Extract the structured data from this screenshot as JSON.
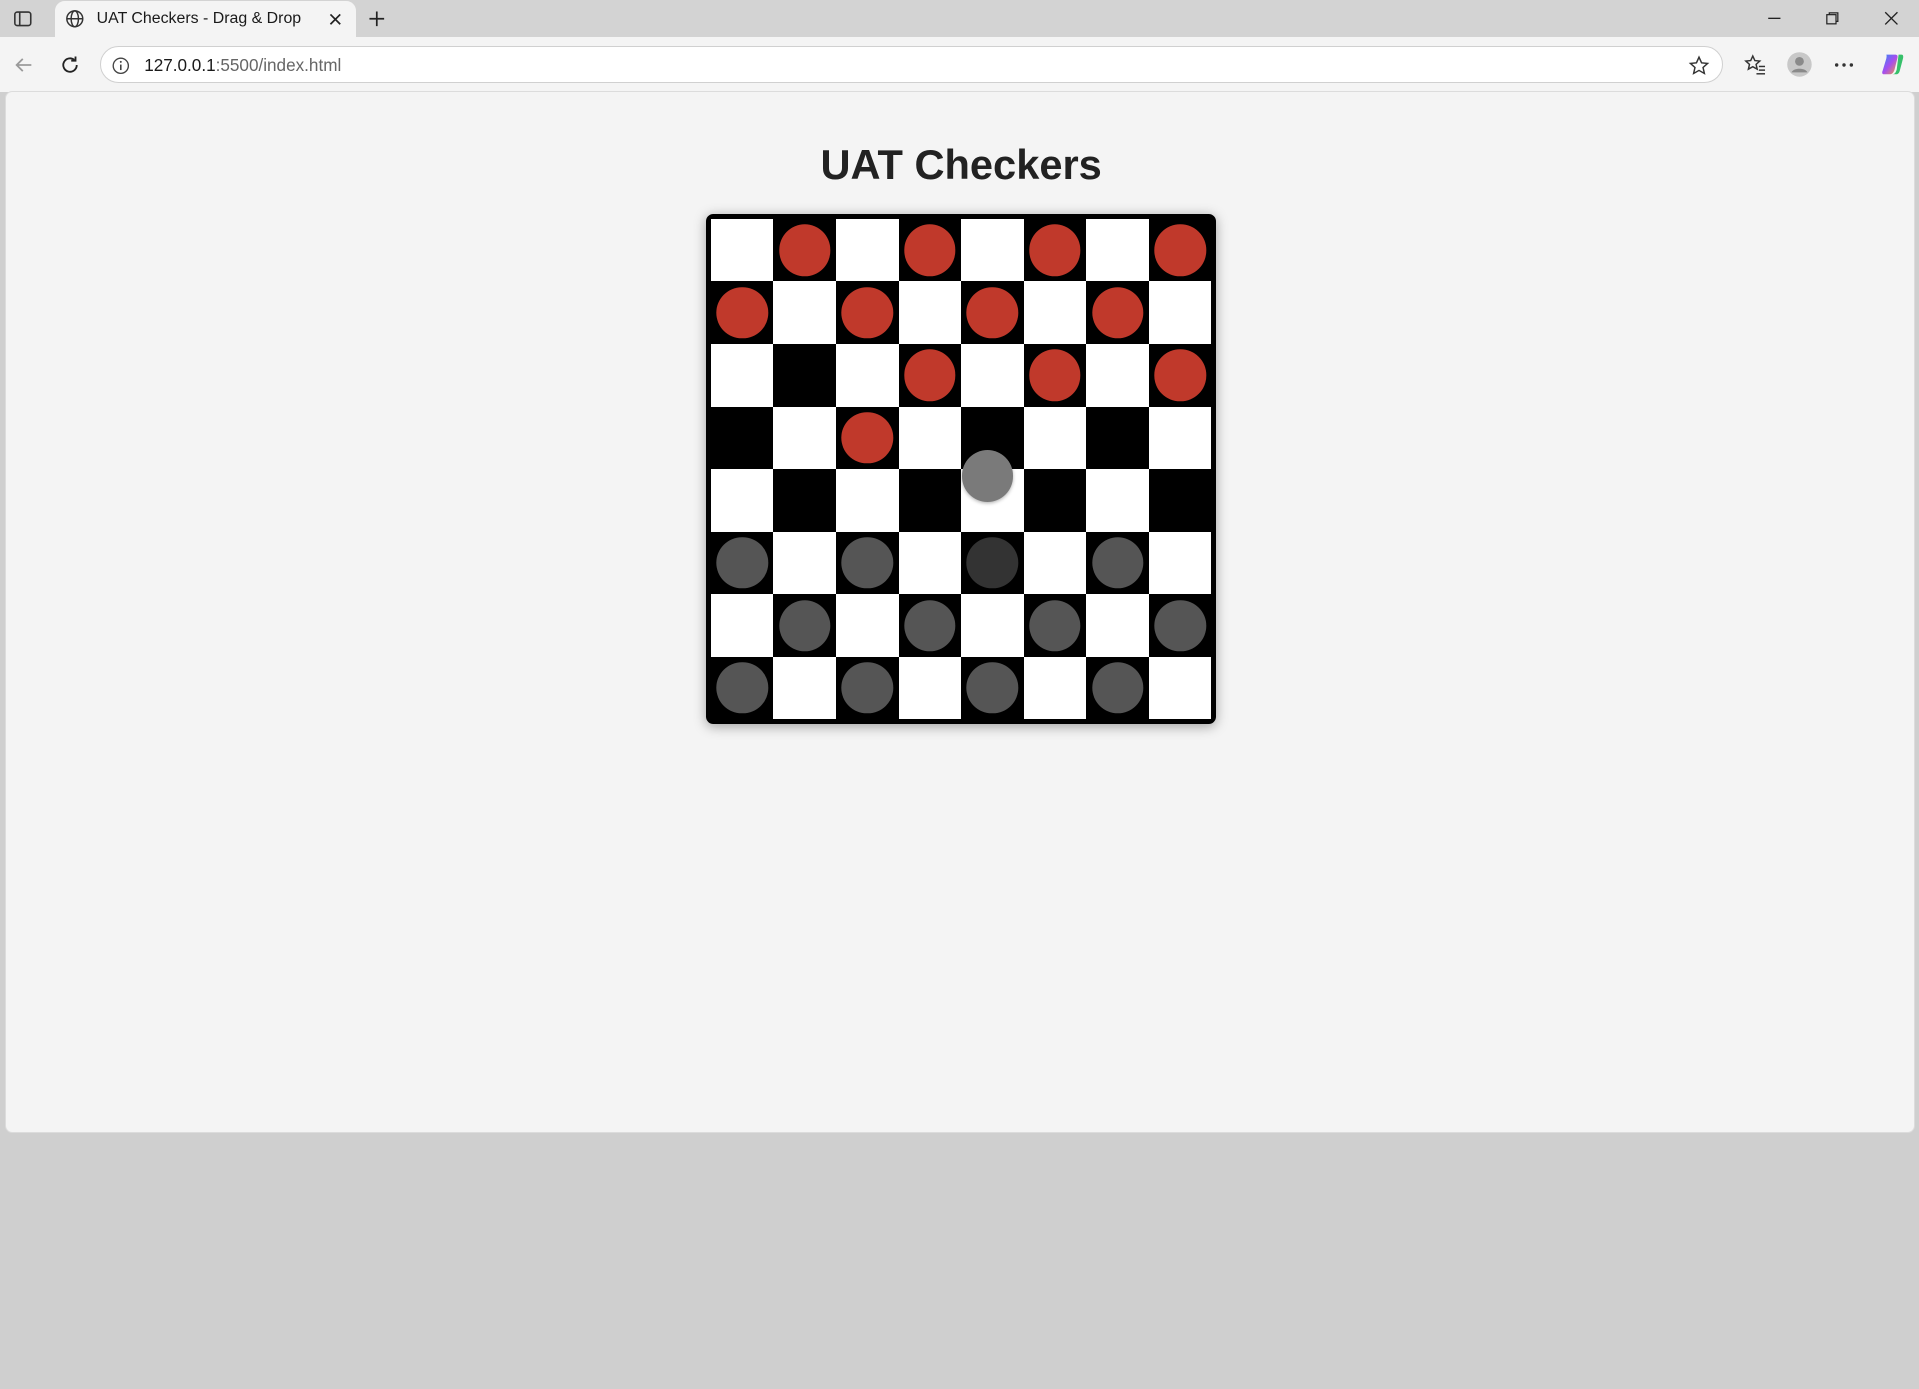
{
  "browser": {
    "tab_title": "UAT Checkers - Drag & Drop",
    "url_host": "127.0.0.1",
    "url_path": ":5500/index.html"
  },
  "page": {
    "title": "UAT Checkers"
  },
  "board": {
    "size": 8,
    "light_color": "#ffffff",
    "dark_color": "#000000",
    "red_color": "#c0392b",
    "gray_color": "#555555",
    "selected_color": "#333333",
    "drag_ghost_color": "#7a7a7a",
    "dark_squares_note": "row 2 col 1, row 3 cols 0,4,6, row 4 cols 1,3,5,7 shown dark; otherwise standard pattern",
    "pieces": [
      {
        "row": 0,
        "col": 1,
        "color": "red"
      },
      {
        "row": 0,
        "col": 3,
        "color": "red"
      },
      {
        "row": 0,
        "col": 5,
        "color": "red"
      },
      {
        "row": 0,
        "col": 7,
        "color": "red"
      },
      {
        "row": 1,
        "col": 0,
        "color": "red"
      },
      {
        "row": 1,
        "col": 2,
        "color": "red"
      },
      {
        "row": 1,
        "col": 4,
        "color": "red"
      },
      {
        "row": 1,
        "col": 6,
        "color": "red"
      },
      {
        "row": 2,
        "col": 3,
        "color": "red"
      },
      {
        "row": 2,
        "col": 5,
        "color": "red"
      },
      {
        "row": 2,
        "col": 7,
        "color": "red"
      },
      {
        "row": 3,
        "col": 2,
        "color": "red"
      },
      {
        "row": 5,
        "col": 0,
        "color": "gray"
      },
      {
        "row": 5,
        "col": 2,
        "color": "gray"
      },
      {
        "row": 5,
        "col": 4,
        "color": "gray",
        "selected": true
      },
      {
        "row": 5,
        "col": 6,
        "color": "gray"
      },
      {
        "row": 6,
        "col": 1,
        "color": "gray"
      },
      {
        "row": 6,
        "col": 3,
        "color": "gray"
      },
      {
        "row": 6,
        "col": 5,
        "color": "gray"
      },
      {
        "row": 6,
        "col": 7,
        "color": "gray"
      },
      {
        "row": 7,
        "col": 0,
        "color": "gray"
      },
      {
        "row": 7,
        "col": 2,
        "color": "gray"
      },
      {
        "row": 7,
        "col": 4,
        "color": "gray"
      },
      {
        "row": 7,
        "col": 6,
        "color": "gray"
      }
    ],
    "square_colors": [
      [
        "light",
        "dark",
        "light",
        "dark",
        "light",
        "dark",
        "light",
        "dark"
      ],
      [
        "dark",
        "light",
        "dark",
        "light",
        "dark",
        "light",
        "dark",
        "light"
      ],
      [
        "light",
        "dark",
        "light",
        "dark",
        "light",
        "dark",
        "light",
        "dark"
      ],
      [
        "dark",
        "light",
        "dark",
        "light",
        "dark",
        "light",
        "dark",
        "light"
      ],
      [
        "light",
        "dark",
        "light",
        "dark",
        "light",
        "dark",
        "light",
        "dark"
      ],
      [
        "dark",
        "light",
        "dark",
        "light",
        "dark",
        "light",
        "dark",
        "light"
      ],
      [
        "light",
        "dark",
        "light",
        "dark",
        "light",
        "dark",
        "light",
        "dark"
      ],
      [
        "dark",
        "light",
        "dark",
        "light",
        "dark",
        "light",
        "dark",
        "light"
      ]
    ]
  }
}
